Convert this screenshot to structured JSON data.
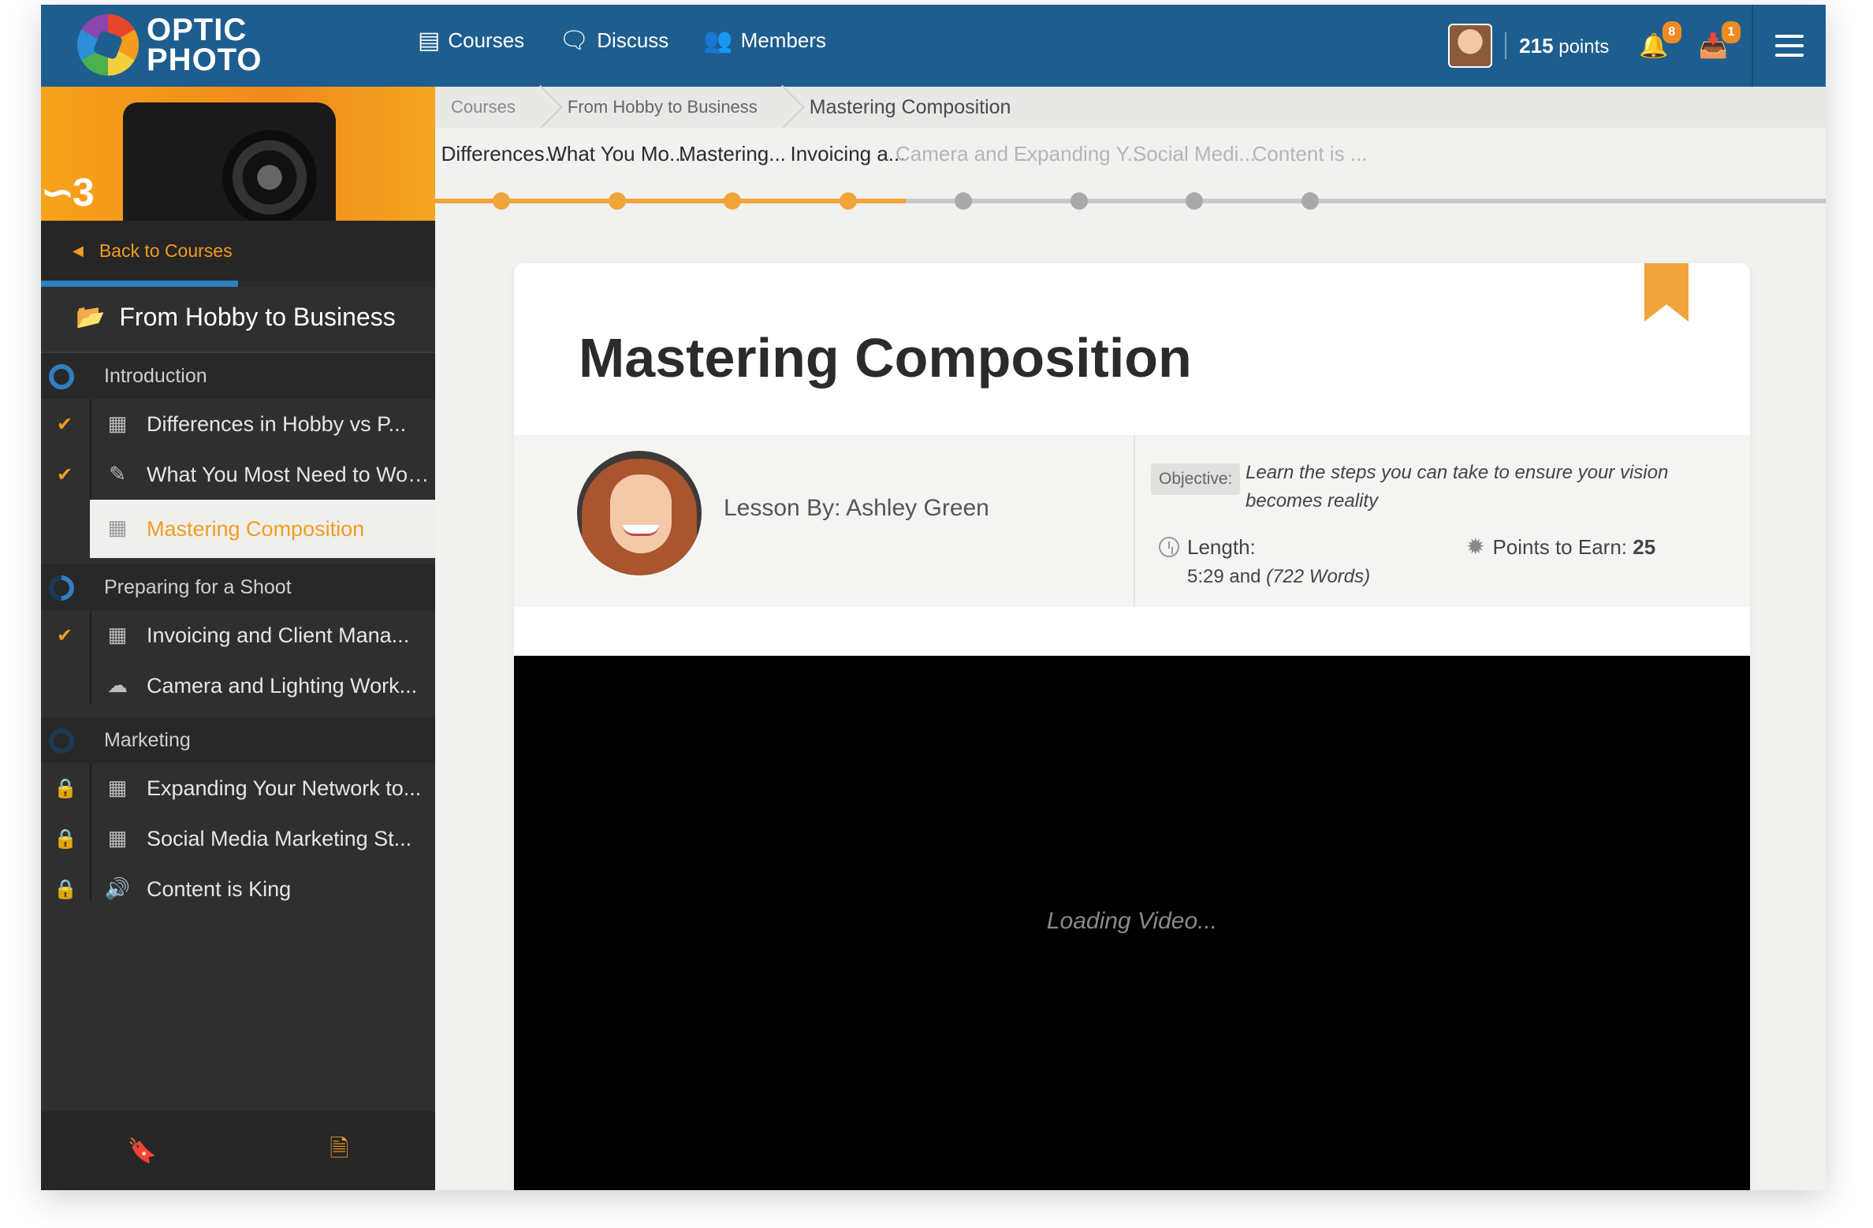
{
  "brand": {
    "line1": "OPTIC",
    "line2": "PHOTO"
  },
  "nav": {
    "links": [
      {
        "label": "Courses",
        "icon": "book-icon"
      },
      {
        "label": "Discuss",
        "icon": "chat-bubbles-icon"
      },
      {
        "label": "Members",
        "icon": "people-icon"
      }
    ],
    "points_value": "215",
    "points_label": "points",
    "notifications_count": "8",
    "messages_count": "1"
  },
  "sidebar": {
    "back_label": "Back to Courses",
    "course_title": "From Hobby to Business",
    "sections": [
      {
        "title": "Introduction",
        "lessons": [
          {
            "label": "Differences in Hobby vs P...",
            "status": "complete",
            "type": "video-icon"
          },
          {
            "label": "What You Most Need to Wor...",
            "status": "complete",
            "type": "pencil-icon"
          },
          {
            "label": "Mastering Composition",
            "status": "complete-current",
            "type": "video-icon"
          }
        ]
      },
      {
        "title": "Preparing for a Shoot",
        "lessons": [
          {
            "label": "Invoicing and Client Mana...",
            "status": "complete",
            "type": "video-icon"
          },
          {
            "label": "Camera and Lighting Work...",
            "status": "open",
            "type": "cloud-download-icon"
          }
        ]
      },
      {
        "title": "Marketing",
        "lessons": [
          {
            "label": "Expanding Your Network to...",
            "status": "locked",
            "type": "video-icon"
          },
          {
            "label": "Social Media Marketing St...",
            "status": "locked",
            "type": "video-icon"
          },
          {
            "label": "Content is King",
            "status": "locked",
            "type": "speaker-icon"
          }
        ]
      }
    ]
  },
  "breadcrumb": {
    "items": [
      "Courses",
      "From Hobby to Business",
      "Mastering Composition"
    ]
  },
  "stepper": {
    "steps": [
      {
        "label": "Differences...",
        "state": "complete"
      },
      {
        "label": "What You Mo...",
        "state": "complete"
      },
      {
        "label": "Mastering...",
        "state": "complete"
      },
      {
        "label": "Invoicing a...",
        "state": "complete"
      },
      {
        "label": "Camera and ...",
        "state": "upcoming"
      },
      {
        "label": "Expanding Y...",
        "state": "upcoming"
      },
      {
        "label": "Social Medi...",
        "state": "upcoming"
      },
      {
        "label": "Content is ...",
        "state": "upcoming"
      }
    ]
  },
  "lesson": {
    "title": "Mastering Composition",
    "author_prefix": "Lesson By:",
    "author_name": "Ashley Green",
    "objective_tag": "Objective:",
    "objective_text": "Learn the steps you can take to ensure your vision becomes reality",
    "length_label": "Length:",
    "length_time": "5:29 and",
    "length_words": "(722 Words)",
    "points_label": "Points to Earn:",
    "points_value": "25",
    "video_status": "Loading Video..."
  },
  "colors": {
    "nav_bg": "#1e5e8f",
    "accent": "#f39c1e",
    "progress_done": "#f0a43a",
    "progress_todo": "#c8c8c8",
    "sidebar_bg": "#2f2f2f"
  }
}
